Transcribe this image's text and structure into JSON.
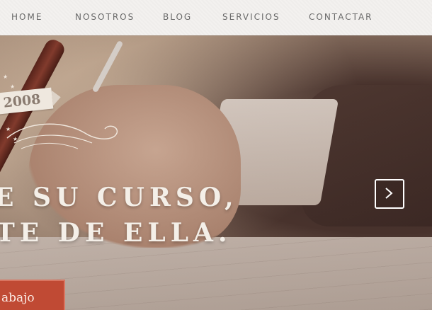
{
  "nav": {
    "items": [
      {
        "label": "HOME"
      },
      {
        "label": "NOSOTROS"
      },
      {
        "label": "BLOG"
      },
      {
        "label": "SERVICIOS"
      },
      {
        "label": "CONTACTAR"
      }
    ]
  },
  "hero": {
    "badge_year": "2008",
    "headline_line1": "E SU CURSO,",
    "headline_line2": "TE DE ELLA.",
    "next_icon": "chevron-right-icon",
    "cta_label": "abajo"
  },
  "colors": {
    "accent": "#c04a34",
    "nav_bg": "#f3f1ef",
    "headline": "#f4efe8"
  }
}
